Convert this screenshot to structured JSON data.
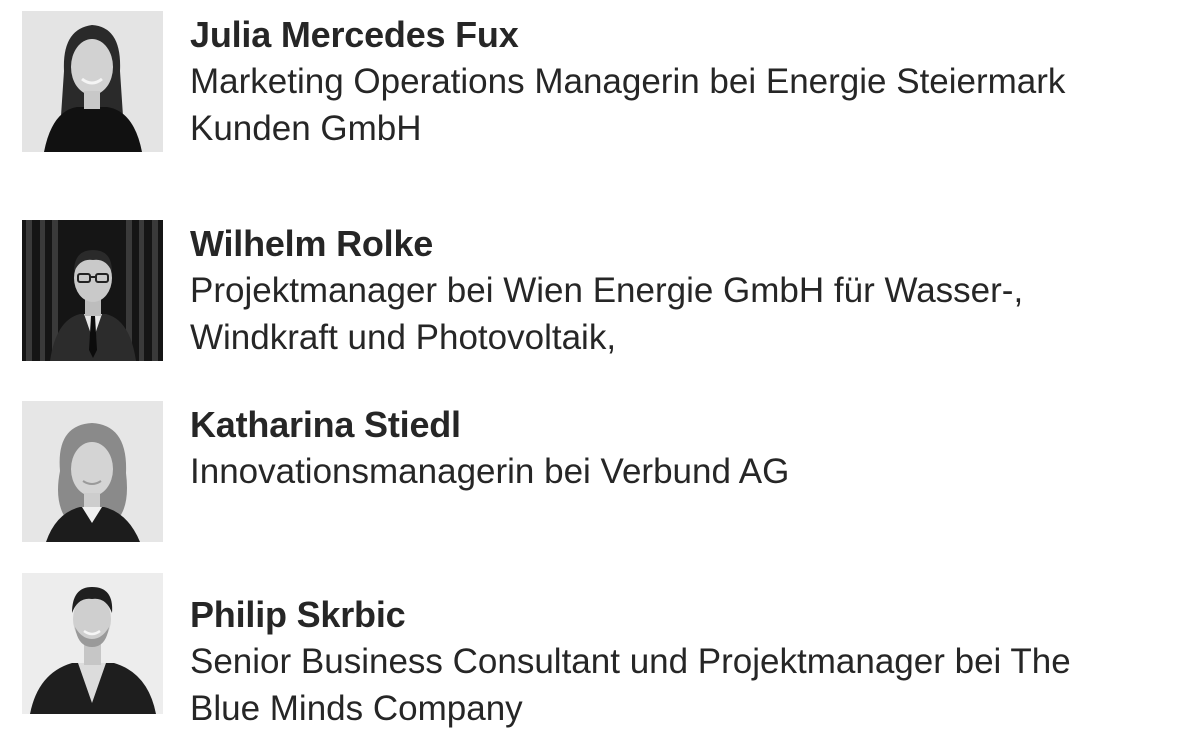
{
  "speakers": [
    {
      "name": "Julia Mercedes Fux",
      "role": "Marketing Operations Managerin bei Energie Steiermark Kunden GmbH",
      "photo_icon": "portrait-photo"
    },
    {
      "name": "Wilhelm Rolke",
      "role": "Projektmanager bei Wien Energie GmbH für Wasser-, Windkraft und Photovoltaik,",
      "photo_icon": "portrait-photo"
    },
    {
      "name": "Katharina Stiedl",
      "role": "Innovationsmanagerin bei Verbund AG",
      "photo_icon": "portrait-photo"
    },
    {
      "name": "Philip Skrbic",
      "role": "Senior Business Consultant und Projektmanager bei The Blue Minds Company",
      "photo_icon": "portrait-photo"
    }
  ]
}
